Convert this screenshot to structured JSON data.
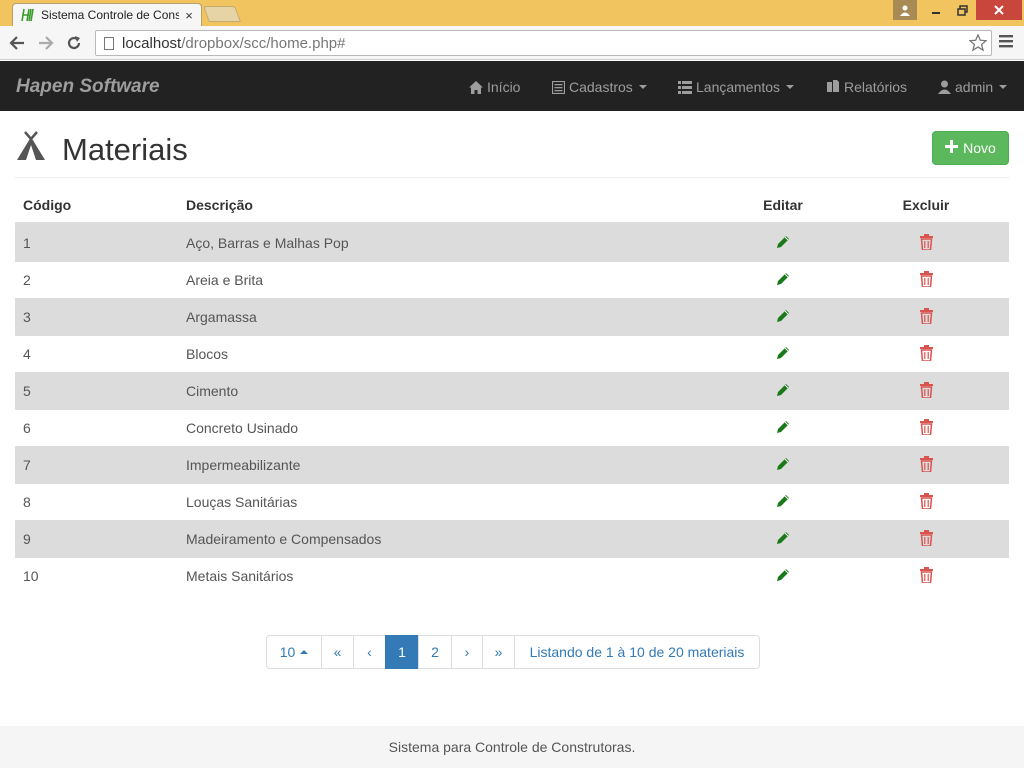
{
  "browser": {
    "tab_title": "Sistema Controle de Cons",
    "url_host": "localhost",
    "url_path": "/dropbox/scc/home.php#",
    "close_glyph": "×",
    "icons": [
      "favicon-icon",
      "back-arrow-icon",
      "forward-arrow-icon",
      "reload-icon",
      "page-icon",
      "star-icon",
      "menu-icon",
      "user-icon"
    ]
  },
  "navbar": {
    "brand": "Hapen Software",
    "items": [
      {
        "label": "Início",
        "icon": "home-icon"
      },
      {
        "label": "Cadastros",
        "icon": "list-alt-icon"
      },
      {
        "label": "Lançamentos",
        "icon": "list-icon"
      },
      {
        "label": "Relatórios",
        "icon": "copy-icon"
      },
      {
        "label": "admin",
        "icon": "user-icon"
      }
    ]
  },
  "page": {
    "title": "Materiais",
    "icon": "tent-icon",
    "new_button": "Novo"
  },
  "table": {
    "headers": {
      "code": "Código",
      "description": "Descrição",
      "edit": "Editar",
      "delete": "Excluir"
    },
    "edit_icon": "pencil-icon",
    "delete_icon": "trash-icon",
    "rows": [
      {
        "code": "1",
        "description": "Aço, Barras e Malhas Pop"
      },
      {
        "code": "2",
        "description": "Areia e Brita"
      },
      {
        "code": "3",
        "description": "Argamassa"
      },
      {
        "code": "4",
        "description": "Blocos"
      },
      {
        "code": "5",
        "description": "Cimento"
      },
      {
        "code": "6",
        "description": "Concreto Usinado"
      },
      {
        "code": "7",
        "description": "Impermeabilizante"
      },
      {
        "code": "8",
        "description": "Louças Sanitárias"
      },
      {
        "code": "9",
        "description": "Madeiramento e Compensados"
      },
      {
        "code": "10",
        "description": "Metais Sanitários"
      }
    ]
  },
  "pagination": {
    "page_size": "10",
    "first": "«",
    "prev": "‹",
    "pages": [
      "1",
      "2"
    ],
    "current_page": "1",
    "next": "›",
    "last": "»",
    "summary": "Listando de 1 à 10 de 20 materiais"
  },
  "footer": {
    "text": "Sistema para Controle de Construtoras."
  },
  "colors": {
    "navbar_bg": "#222222",
    "navbar_text": "#9d9d9d",
    "success": "#5cb85c",
    "edit_green": "#1a7a1a",
    "danger": "#d9534f",
    "primary": "#337ab7",
    "row_stripe": "#dcdcdc",
    "browser_frame": "#f2c45f"
  }
}
